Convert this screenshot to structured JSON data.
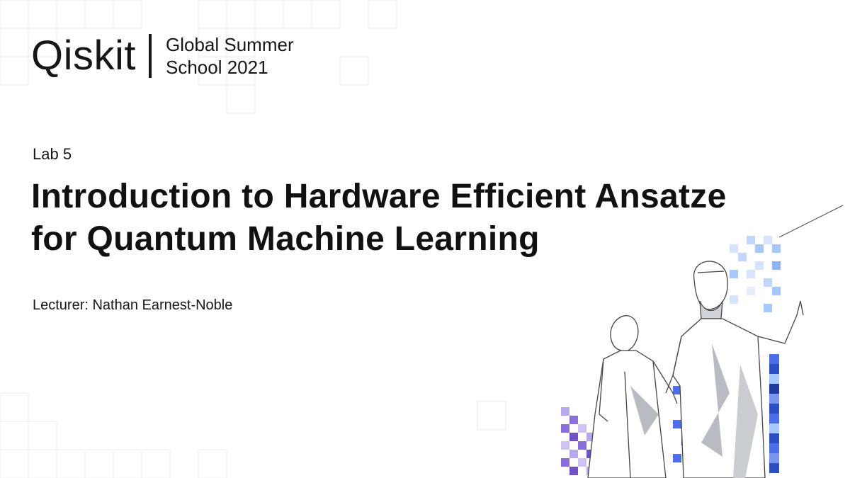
{
  "logo": {
    "word": "Qiskit",
    "event_line1": "Global Summer",
    "event_line2": "School 2021"
  },
  "lab_label": "Lab 5",
  "title_line1": "Introduction to Hardware Efficient Ansatze",
  "title_line2": "for Quantum Machine Learning",
  "lecturer": "Lecturer: Nathan Earnest-Noble",
  "illustration": "two-people-pointing-illustration",
  "colors": {
    "text": "#161616",
    "grid_line": "#e8e8e8",
    "accent_blue": "#4c6ee6",
    "accent_light_blue": "#a6c8ff",
    "accent_purple": "#8a6fd8"
  }
}
